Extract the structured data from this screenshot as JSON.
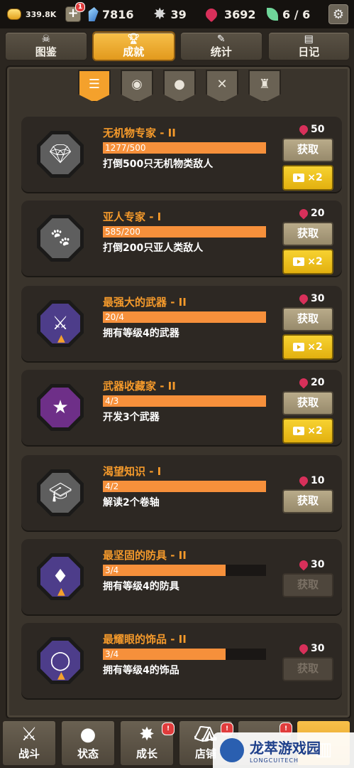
{
  "top_bar": {
    "gold": "339.8K",
    "plus_badge": "1",
    "crystals": "7816",
    "stars": "39",
    "rubies": "3692",
    "energy": "6 / 6"
  },
  "tabs": [
    {
      "label": "图鉴",
      "icon": "skull-icon"
    },
    {
      "label": "成就",
      "icon": "trophy-icon"
    },
    {
      "label": "统计",
      "icon": "feather-icon"
    },
    {
      "label": "日记",
      "icon": "journal-icon"
    }
  ],
  "filters": [
    {
      "icon": "list-icon",
      "active": true
    },
    {
      "icon": "globe-icon",
      "active": false
    },
    {
      "icon": "person-icon",
      "active": false
    },
    {
      "icon": "crossed-swords-icon",
      "active": false
    },
    {
      "icon": "bag-icon",
      "active": false
    }
  ],
  "achievements": [
    {
      "title": "无机物专家 - II",
      "progress_text": "1277/500",
      "progress": 1.0,
      "desc": "打倒500只无机物类敌人",
      "reward": "50",
      "claim": "获取",
      "ad": "×2",
      "claimable": true,
      "badge_icon": "diamond-icon"
    },
    {
      "title": "亚人专家 - I",
      "progress_text": "585/200",
      "progress": 1.0,
      "desc": "打倒200只亚人类敌人",
      "reward": "20",
      "claim": "获取",
      "ad": "×2",
      "claimable": true,
      "badge_icon": "beast-icon"
    },
    {
      "title": "最强大的武器 - II",
      "progress_text": "20/4",
      "progress": 1.0,
      "desc": "拥有等级4的武器",
      "reward": "30",
      "claim": "获取",
      "ad": "×2",
      "claimable": true,
      "badge_icon": "claw-weapon-icon"
    },
    {
      "title": "武器收藏家 - II",
      "progress_text": "4/3",
      "progress": 1.0,
      "desc": "开发3个武器",
      "reward": "20",
      "claim": "获取",
      "ad": "×2",
      "claimable": true,
      "badge_icon": "weapon-collection-icon"
    },
    {
      "title": "渴望知识 - I",
      "progress_text": "4/2",
      "progress": 1.0,
      "desc": "解读2个卷轴",
      "reward": "10",
      "claim": "获取",
      "claimable": true,
      "badge_icon": "graduation-cap-icon"
    },
    {
      "title": "最坚固的防具 - II",
      "progress_text": "3/4",
      "progress": 0.75,
      "desc": "拥有等级4的防具",
      "reward": "30",
      "claim": "获取",
      "claimable": false,
      "badge_icon": "armor-icon"
    },
    {
      "title": "最耀眼的饰品 - II",
      "progress_text": "3/4",
      "progress": 0.75,
      "desc": "拥有等级4的饰品",
      "reward": "30",
      "claim": "获取",
      "claimable": false,
      "badge_icon": "ring-icon"
    }
  ],
  "bottom_nav": [
    {
      "label": "战斗",
      "icon": "crossed-swords-icon",
      "alert": false
    },
    {
      "label": "状态",
      "icon": "person-icon",
      "alert": false
    },
    {
      "label": "成长",
      "icon": "sparkle-icon",
      "alert": true
    },
    {
      "label": "店铺",
      "icon": "shop-icon",
      "alert": true
    },
    {
      "label": "",
      "icon": "tower-icon",
      "alert": true
    },
    {
      "label": "",
      "icon": "book-icon",
      "alert": false
    }
  ],
  "watermark": {
    "title": "龙萃游戏园",
    "subtitle": "LONGCUITECH"
  }
}
